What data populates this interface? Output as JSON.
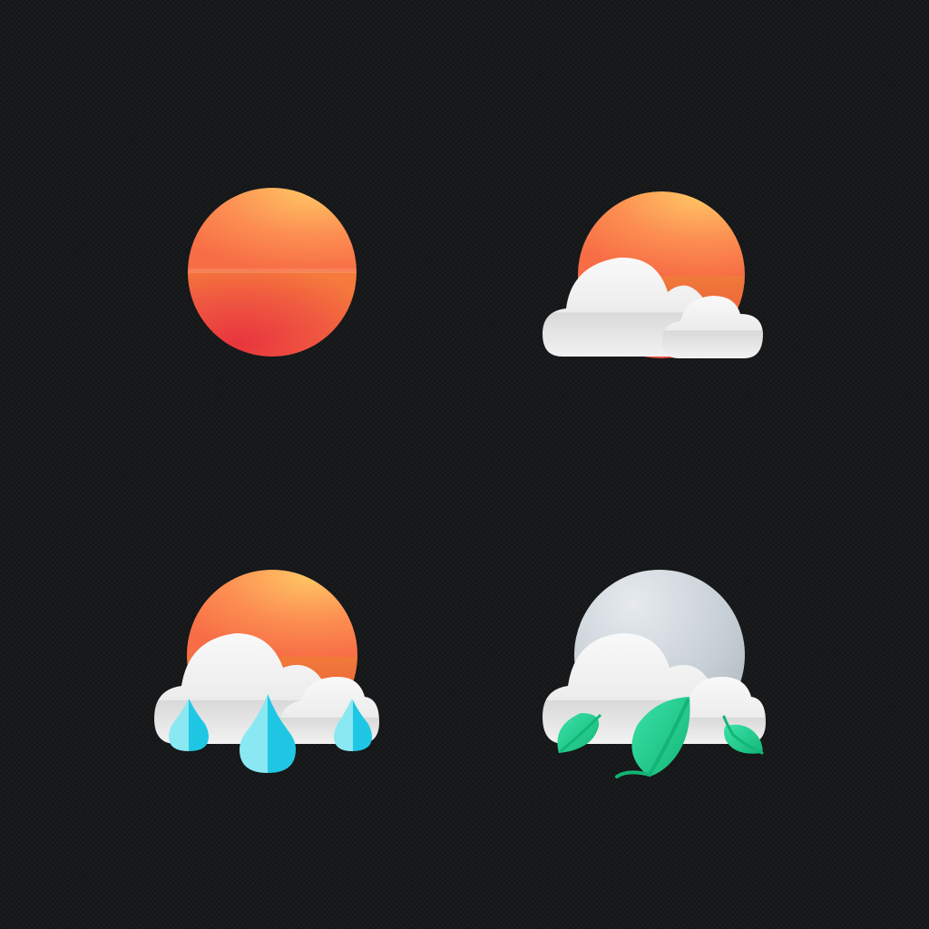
{
  "icons": [
    {
      "id": "sunny",
      "name": "sun-icon",
      "description_kind": "sun"
    },
    {
      "id": "partly_cloudy",
      "name": "partly-cloudy-icon",
      "description_kind": "sun-behind-cloud"
    },
    {
      "id": "rain",
      "name": "rain-icon",
      "description_kind": "sun-cloud-rain"
    },
    {
      "id": "windy",
      "name": "windy-leaves-icon",
      "description_kind": "moon-cloud-leaves"
    }
  ],
  "colors": {
    "background": "#17191b",
    "sun_top": "#ffc064",
    "sun_mid": "#fb8a4d",
    "sun_bottom": "#e8393f",
    "cloud_light": "#f7f7f7",
    "cloud_shadow": "#d2d2d2",
    "moon_light": "#e4e8ec",
    "moon_dark": "#aeb7bf",
    "raindrop_light": "#7fe3f0",
    "raindrop_dark": "#1ec6e4",
    "leaf_light": "#36e0a4",
    "leaf_dark": "#14b878"
  }
}
